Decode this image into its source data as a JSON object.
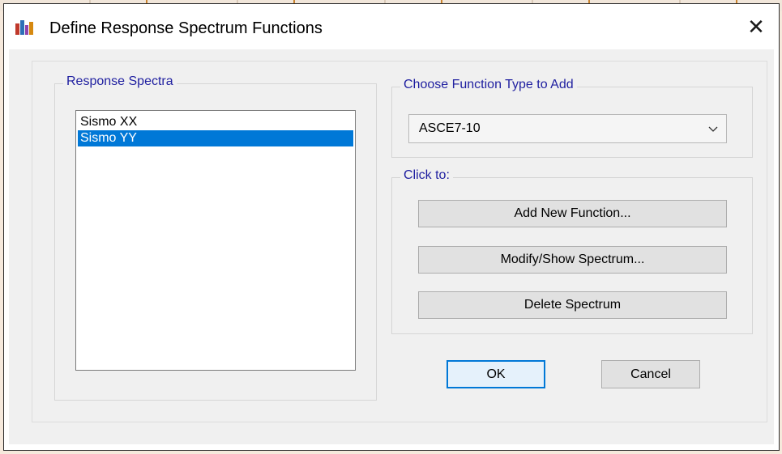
{
  "window": {
    "title": "Define Response Spectrum Functions",
    "close_symbol": "✕",
    "icon": "etabs-app-icon"
  },
  "response_spectra": {
    "legend": "Response Spectra",
    "items": [
      {
        "label": "Sismo XX",
        "selected": false
      },
      {
        "label": "Sismo YY",
        "selected": true
      }
    ]
  },
  "function_type": {
    "legend": "Choose  Function Type to Add",
    "selected": "ASCE7-10"
  },
  "click_to": {
    "legend": "Click to:",
    "add_label": "Add New Function...",
    "modify_label": "Modify/Show Spectrum...",
    "delete_label": "Delete Spectrum"
  },
  "footer": {
    "ok_label": "OK",
    "cancel_label": "Cancel"
  },
  "colors": {
    "legend_text": "#1f1fa0",
    "selection": "#0078d7",
    "dialog_bg": "#f0f0f0"
  }
}
